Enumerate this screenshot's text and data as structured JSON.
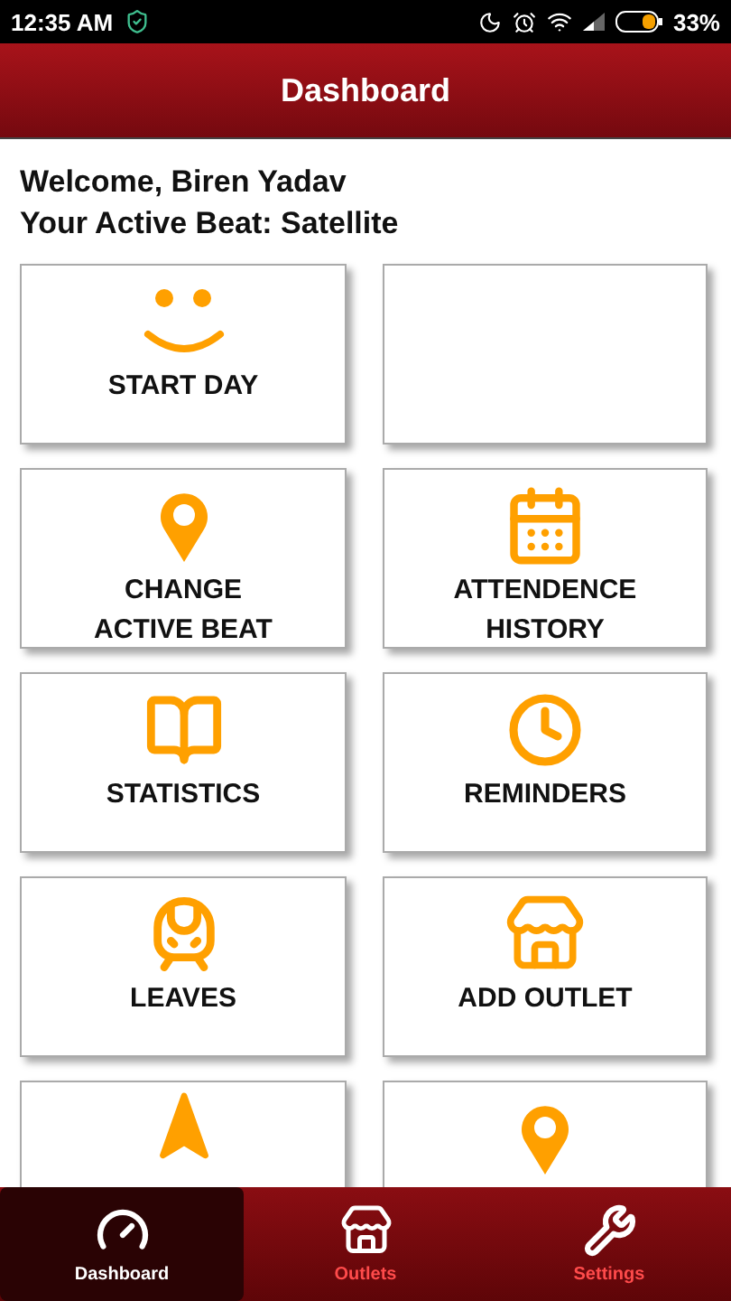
{
  "status_bar": {
    "time": "12:35 AM",
    "battery": "33%"
  },
  "header": {
    "title": "Dashboard"
  },
  "welcome": {
    "greeting": "Welcome, Biren Yadav",
    "beat": "Your Active Beat: Satellite"
  },
  "tiles": [
    {
      "kind": "smile",
      "lines": [
        "START DAY"
      ]
    },
    {
      "kind": "none"
    },
    {
      "kind": "pin",
      "lines": [
        "CHANGE",
        "ACTIVE BEAT"
      ]
    },
    {
      "kind": "calendar",
      "lines": [
        "ATTENDENCE",
        "HISTORY"
      ]
    },
    {
      "kind": "book",
      "lines": [
        "STATISTICS"
      ]
    },
    {
      "kind": "clock",
      "lines": [
        "REMINDERS"
      ]
    },
    {
      "kind": "train",
      "lines": [
        "LEAVES"
      ]
    },
    {
      "kind": "store",
      "lines": [
        "ADD OUTLET"
      ]
    },
    {
      "kind": "navigation"
    },
    {
      "kind": "pin"
    }
  ],
  "bottom_nav": [
    {
      "kind": "gauge",
      "label": "Dashboard",
      "selected": true
    },
    {
      "kind": "store",
      "label": "Outlets",
      "selected": false
    },
    {
      "kind": "tools",
      "label": "Settings",
      "selected": false
    }
  ]
}
